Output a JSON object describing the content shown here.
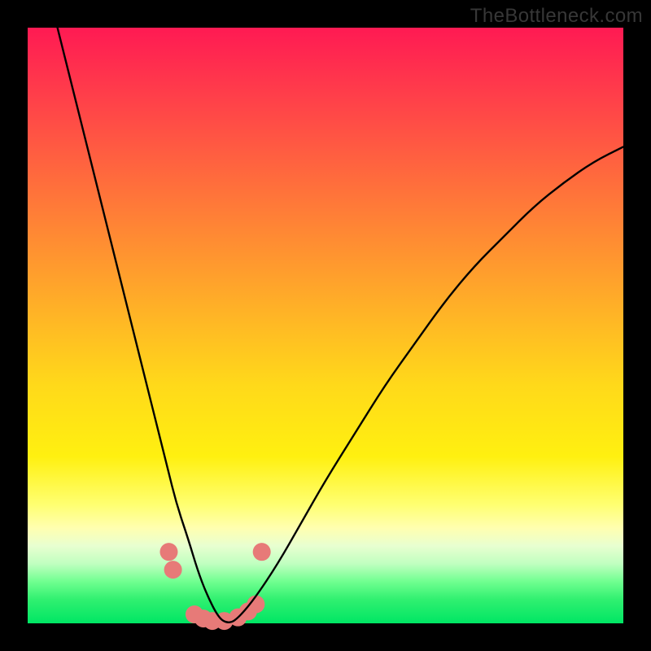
{
  "watermark": "TheBottleneck.com",
  "chart_data": {
    "type": "line",
    "title": "",
    "xlabel": "",
    "ylabel": "",
    "xlim": [
      0,
      100
    ],
    "ylim": [
      0,
      100
    ],
    "series": [
      {
        "name": "bottleneck-curve",
        "x": [
          5,
          8,
          10,
          12,
          14,
          16,
          18,
          20,
          22,
          23.5,
          25,
          27,
          28.5,
          30,
          32,
          33.5,
          35,
          38,
          42,
          46,
          50,
          55,
          60,
          65,
          70,
          75,
          80,
          85,
          90,
          95,
          100
        ],
        "y": [
          100,
          88,
          80,
          72,
          64,
          56,
          48,
          40,
          32,
          26,
          20,
          14,
          9,
          5,
          1,
          0,
          0.5,
          4,
          10,
          17,
          24,
          32,
          40,
          47,
          54,
          60,
          65,
          70,
          74,
          77.5,
          80
        ]
      }
    ],
    "markers": {
      "name": "highlighted-points",
      "color": "#e77a78",
      "points": [
        {
          "x": 23.7,
          "y": 12
        },
        {
          "x": 24.4,
          "y": 9
        },
        {
          "x": 28.0,
          "y": 1.5
        },
        {
          "x": 29.5,
          "y": 0.8
        },
        {
          "x": 31.0,
          "y": 0.4
        },
        {
          "x": 33.0,
          "y": 0.4
        },
        {
          "x": 35.3,
          "y": 1.0
        },
        {
          "x": 37.0,
          "y": 2.0
        },
        {
          "x": 38.3,
          "y": 3.2
        },
        {
          "x": 39.3,
          "y": 12
        }
      ]
    }
  },
  "colors": {
    "curve": "#000000",
    "marker": "#e77a78",
    "background_frame": "#000000"
  }
}
